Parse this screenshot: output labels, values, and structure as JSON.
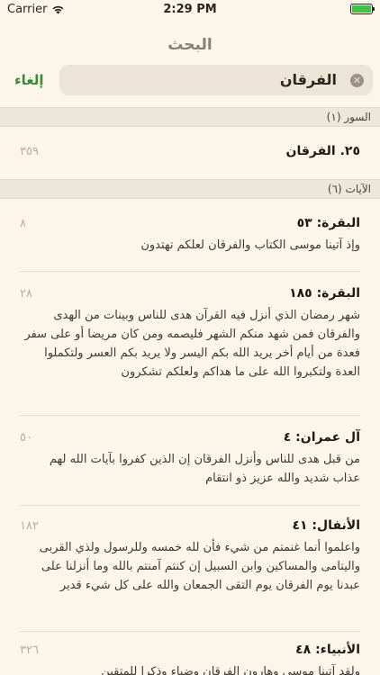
{
  "status": {
    "carrier": "Carrier",
    "time": "2:29 PM",
    "battery_pct": 100,
    "battery_color": "#3fc14a"
  },
  "nav": {
    "title": "البحث"
  },
  "search": {
    "value": "الفرقان",
    "cancel_label": "إلغاء"
  },
  "sections": {
    "surahs_header": "السور (١)",
    "ayahs_header": "الآيات (٦)"
  },
  "surahs": [
    {
      "title": "٢٥. الفرقان",
      "count": "٣٥٩"
    }
  ],
  "ayahs": [
    {
      "title": "البقرة: ٥٣",
      "num": "٨",
      "text": "وإذ آتينا موسى الكتاب والفرقان لعلكم تهتدون"
    },
    {
      "title": "البقرة: ١٨٥",
      "num": "٢٨",
      "text": "شهر رمضان الذي أنزل فيه القرآن هدى للناس وبينات من الهدى والفرقان فمن شهد منكم الشهر فليصمه ومن كان مريضا أو على سفر فعدة من أيام أخر يريد الله بكم اليسر ولا يريد بكم العسر ولتكملوا العدة ولتكبروا الله على ما هداكم ولعلكم تشكرون"
    },
    {
      "title": "آل عمران: ٤",
      "num": "٥٠",
      "text": "من قبل هدى للناس وأنزل الفرقان إن الذين كفروا بآيات الله لهم عذاب شديد والله عزيز ذو انتقام"
    },
    {
      "title": "الأنفال: ٤١",
      "num": "١٨٢",
      "text": "واعلموا أنما غنمتم من شيء فأن لله خمسه وللرسول ولذي القربى واليتامى والمساكين وابن السبيل إن كنتم آمنتم بالله وما أنزلنا على عبدنا يوم الفرقان يوم التقى الجمعان والله على كل شيء قدير"
    },
    {
      "title": "الأنبياء: ٤٨",
      "num": "٣٢٦",
      "text": "ولقد آتينا موسى وهارون الفرقان وضياء وذكرا للمتقين"
    }
  ]
}
